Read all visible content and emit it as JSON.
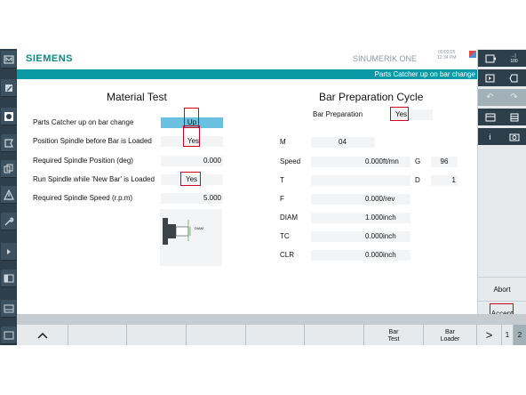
{
  "header": {
    "brand": "SIEMENS",
    "product": "SINUMERIK ONE",
    "date": "05/02/25",
    "time": "12:34 PM",
    "title": "Parts Catcher up on bar change"
  },
  "material_test": {
    "title": "Material Test",
    "rows": [
      {
        "label": "Parts Catcher up on bar change",
        "value": "Up"
      },
      {
        "label": "Position Spindle before Bar is Loaded",
        "value": "Yes"
      },
      {
        "label": "Required Spindle Position (deg)",
        "value": "0.000"
      },
      {
        "label": "Run Spindle while 'New Bar' is Loaded",
        "value": "Yes"
      },
      {
        "label": "Required Spindle Speed (r.p.m)",
        "value": "5.000"
      }
    ],
    "diagram_label": "DIAM"
  },
  "bar_prep": {
    "title": "Bar Preparation Cycle",
    "bar_preparation_label": "Bar Preparation",
    "bar_preparation_value": "Yes",
    "m_label": "M",
    "m_value": "04",
    "speed_label": "Speed",
    "speed_value": "0.000",
    "speed_unit": "ft/mn",
    "g_label": "G",
    "g_value": "96",
    "t_label": "T",
    "t_value": "",
    "d_label": "D",
    "d_value": "1",
    "f_label": "F",
    "f_value": "0.000",
    "f_unit": "/rev",
    "diam_label": "DIAM",
    "diam_value": "1.000",
    "diam_unit": "inch",
    "tc_label": "TC",
    "tc_value": "0.000",
    "tc_unit": "inch",
    "clr_label": "CLR",
    "clr_value": "0.000",
    "clr_unit": "inch"
  },
  "right_panel": {
    "top_right_label": "100",
    "abort_label": "Abort",
    "accept_label": "Accept"
  },
  "softkeys": {
    "bar_test_line1": "Bar",
    "bar_test_line2": "Test",
    "bar_loader_line1": "Bar",
    "bar_loader_line2": "Loader",
    "next_symbol": ">",
    "page1": "1",
    "page2": "2"
  },
  "colors": {
    "teal": "#0a9aa6",
    "highlight": "#6bbfe0",
    "annotation_red": "#d1001f"
  }
}
